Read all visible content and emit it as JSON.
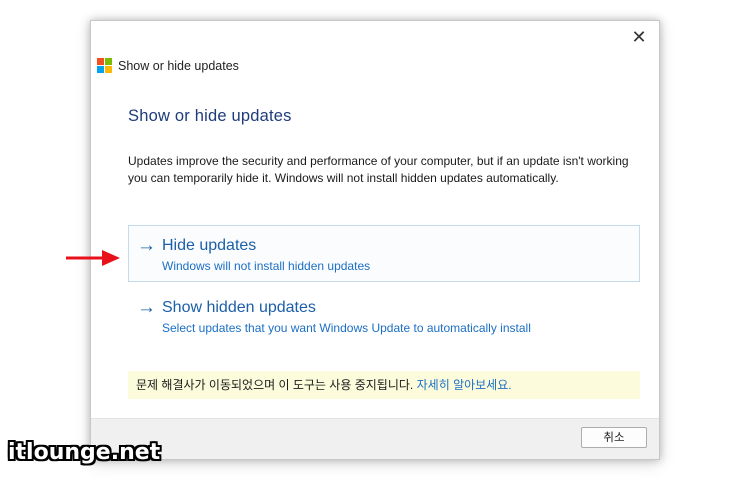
{
  "window": {
    "title": "Show or hide updates",
    "close_glyph": "✕"
  },
  "colors": {
    "logo_tl": "#f25022",
    "logo_tr": "#7fba00",
    "logo_bl": "#00a4ef",
    "logo_br": "#ffb900",
    "annotation_arrow": "#e8101a"
  },
  "main": {
    "heading": "Show or hide updates",
    "description": "Updates improve the security and performance of your computer, but if an update isn't working you can temporarily hide it. Windows will not install hidden updates automatically.",
    "options": [
      {
        "icon": "arrow-right-icon",
        "arrow": "→",
        "title": "Hide updates",
        "subtitle": "Windows will not install hidden updates"
      },
      {
        "icon": "arrow-right-icon",
        "arrow": "→",
        "title": "Show hidden updates",
        "subtitle": "Select updates that you want Windows Update to automatically install"
      }
    ],
    "notice": {
      "text": "문제 해결사가 이동되었으며 이 도구는 사용 중지됩니다. ",
      "link": "자세히 알아보세요."
    }
  },
  "footer": {
    "cancel_label": "취소"
  },
  "watermark": "itlounge.net"
}
